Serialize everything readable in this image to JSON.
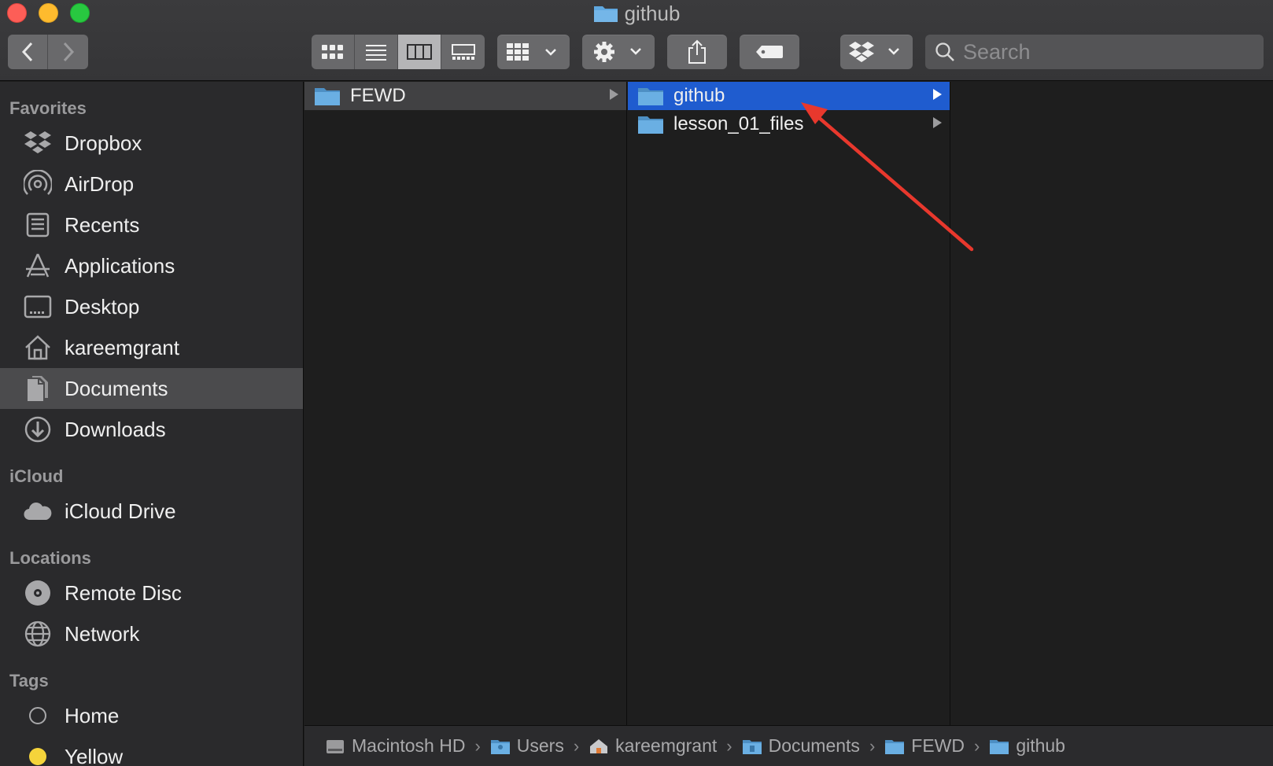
{
  "window": {
    "title": "github"
  },
  "toolbar": {
    "back_icon": "chevron-left-icon",
    "forward_icon": "chevron-right-icon",
    "view_modes": [
      "icon-view",
      "list-view",
      "column-view",
      "gallery-view"
    ],
    "active_view": "column-view",
    "group_icon": "grid-group-icon",
    "action_icon": "gear-icon",
    "share_icon": "share-icon",
    "tag_icon": "tag-icon",
    "dropbox_icon": "dropbox-icon",
    "search": {
      "placeholder": "Search",
      "value": ""
    }
  },
  "sidebar": {
    "sections": [
      {
        "title": "Favorites",
        "items": [
          {
            "label": "Dropbox",
            "icon": "dropbox-icon"
          },
          {
            "label": "AirDrop",
            "icon": "airdrop-icon"
          },
          {
            "label": "Recents",
            "icon": "recents-icon"
          },
          {
            "label": "Applications",
            "icon": "applications-icon"
          },
          {
            "label": "Desktop",
            "icon": "desktop-icon"
          },
          {
            "label": "kareemgrant",
            "icon": "home-icon"
          },
          {
            "label": "Documents",
            "icon": "documents-icon",
            "selected": true
          },
          {
            "label": "Downloads",
            "icon": "downloads-icon"
          }
        ]
      },
      {
        "title": "iCloud",
        "items": [
          {
            "label": "iCloud Drive",
            "icon": "cloud-icon"
          }
        ]
      },
      {
        "title": "Locations",
        "items": [
          {
            "label": "Remote Disc",
            "icon": "disc-icon"
          },
          {
            "label": "Network",
            "icon": "globe-icon"
          }
        ]
      },
      {
        "title": "Tags",
        "items": [
          {
            "label": "Home",
            "icon": "tag-empty-icon"
          },
          {
            "label": "Yellow",
            "icon": "tag-yellow-icon"
          }
        ]
      }
    ]
  },
  "columns": [
    {
      "items": [
        {
          "name": "FEWD",
          "type": "folder",
          "state": "parent"
        }
      ]
    },
    {
      "items": [
        {
          "name": "github",
          "type": "folder",
          "state": "selected"
        },
        {
          "name": "lesson_01_files",
          "type": "folder",
          "state": "none"
        }
      ]
    },
    {
      "items": []
    }
  ],
  "pathbar": [
    {
      "label": "Macintosh HD",
      "icon": "harddrive-icon"
    },
    {
      "label": "Users",
      "icon": "users-folder-icon"
    },
    {
      "label": "kareemgrant",
      "icon": "home-icon"
    },
    {
      "label": "Documents",
      "icon": "documents-folder-icon"
    },
    {
      "label": "FEWD",
      "icon": "folder-icon"
    },
    {
      "label": "github",
      "icon": "folder-icon"
    }
  ],
  "colors": {
    "selection": "#1f5ccf",
    "folder": "#5fa8e0",
    "annotation_arrow": "#e8382d",
    "tag_yellow": "#f5d43b"
  }
}
